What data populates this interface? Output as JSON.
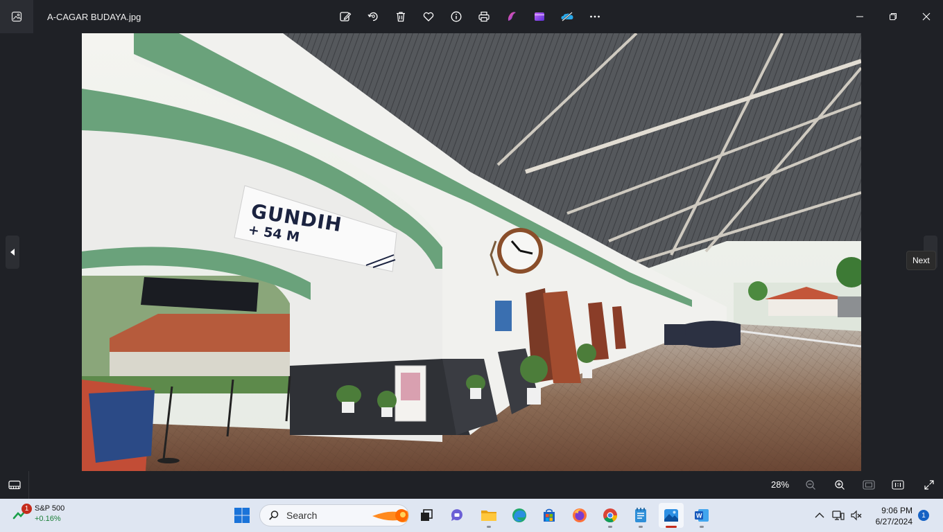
{
  "app": {
    "file_name": "A-CAGAR BUDAYA.jpg",
    "toolbar": [
      "edit-image-icon",
      "rotate-icon",
      "delete-icon",
      "favorite-icon",
      "info-icon",
      "print-icon",
      "clipchamp-icon",
      "video-editor-icon",
      "onedrive-icon",
      "more-icon"
    ]
  },
  "photo": {
    "sign_title": "GUNDIH",
    "sign_subtitle": "+ 54 M"
  },
  "navigation": {
    "next_tooltip": "Next"
  },
  "bottombar": {
    "zoom_level": "28%",
    "zoom_percent": 28
  },
  "taskbar": {
    "widget": {
      "badge": "1",
      "name": "S&P 500",
      "change": "+0.16%"
    },
    "search_placeholder": "Search",
    "clock": {
      "time": "9:06 PM",
      "date": "6/27/2024"
    },
    "notification_count": "1",
    "apps": [
      "task-view",
      "teams-chat",
      "file-explorer",
      "edge",
      "microsoft-store",
      "firefox",
      "chrome",
      "notepad",
      "photos",
      "word"
    ]
  },
  "colors": {
    "app_bg": "#1f2126",
    "taskbar_bg": "#dfe6f2",
    "accent_red": "#c42b1c",
    "accent_blue": "#1662c4"
  }
}
